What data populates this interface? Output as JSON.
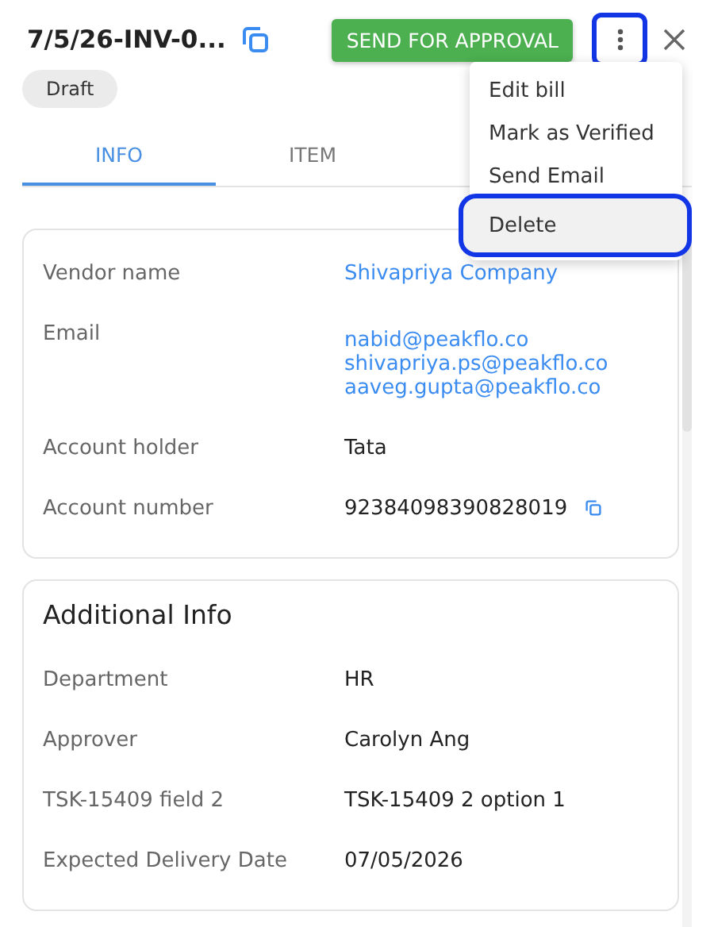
{
  "header": {
    "title": "7/5/26-INV-0...",
    "primary_button": "SEND FOR APPROVAL",
    "more_button": {
      "highlighted": true
    },
    "status": "Draft"
  },
  "tabs": [
    {
      "label": "INFO",
      "selected": true
    },
    {
      "label": "ITEM",
      "selected": false
    }
  ],
  "vendor_card": {
    "rows": [
      {
        "label": "Vendor name",
        "values": [
          "Shivapriya Company"
        ],
        "kind": "link"
      },
      {
        "label": "Email",
        "values": [
          "nabid@peakflo.co",
          "shivapriya.ps@peakflo.co",
          "aaveg.gupta@peakflo.co"
        ],
        "kind": "link"
      },
      {
        "label": "Account holder",
        "values": [
          "Tata"
        ],
        "kind": "text"
      },
      {
        "label": "Account number",
        "values": [
          "92384098390828019"
        ],
        "kind": "copy"
      }
    ]
  },
  "additional_card": {
    "title": "Additional Info",
    "rows": [
      {
        "label": "Department",
        "value": "HR"
      },
      {
        "label": "Approver",
        "value": "Carolyn Ang"
      },
      {
        "label": "TSK-15409 field 2",
        "value": "TSK-15409 2 option 1"
      },
      {
        "label": "Expected Delivery Date",
        "value": "07/05/2026"
      }
    ]
  },
  "menu": {
    "items": [
      {
        "label": "Edit bill",
        "hovered": false,
        "highlighted": false
      },
      {
        "label": "Mark as Verified",
        "hovered": false,
        "highlighted": false
      },
      {
        "label": "Send Email",
        "hovered": false,
        "highlighted": false
      },
      {
        "label": "Delete",
        "hovered": true,
        "highlighted": true
      }
    ]
  }
}
